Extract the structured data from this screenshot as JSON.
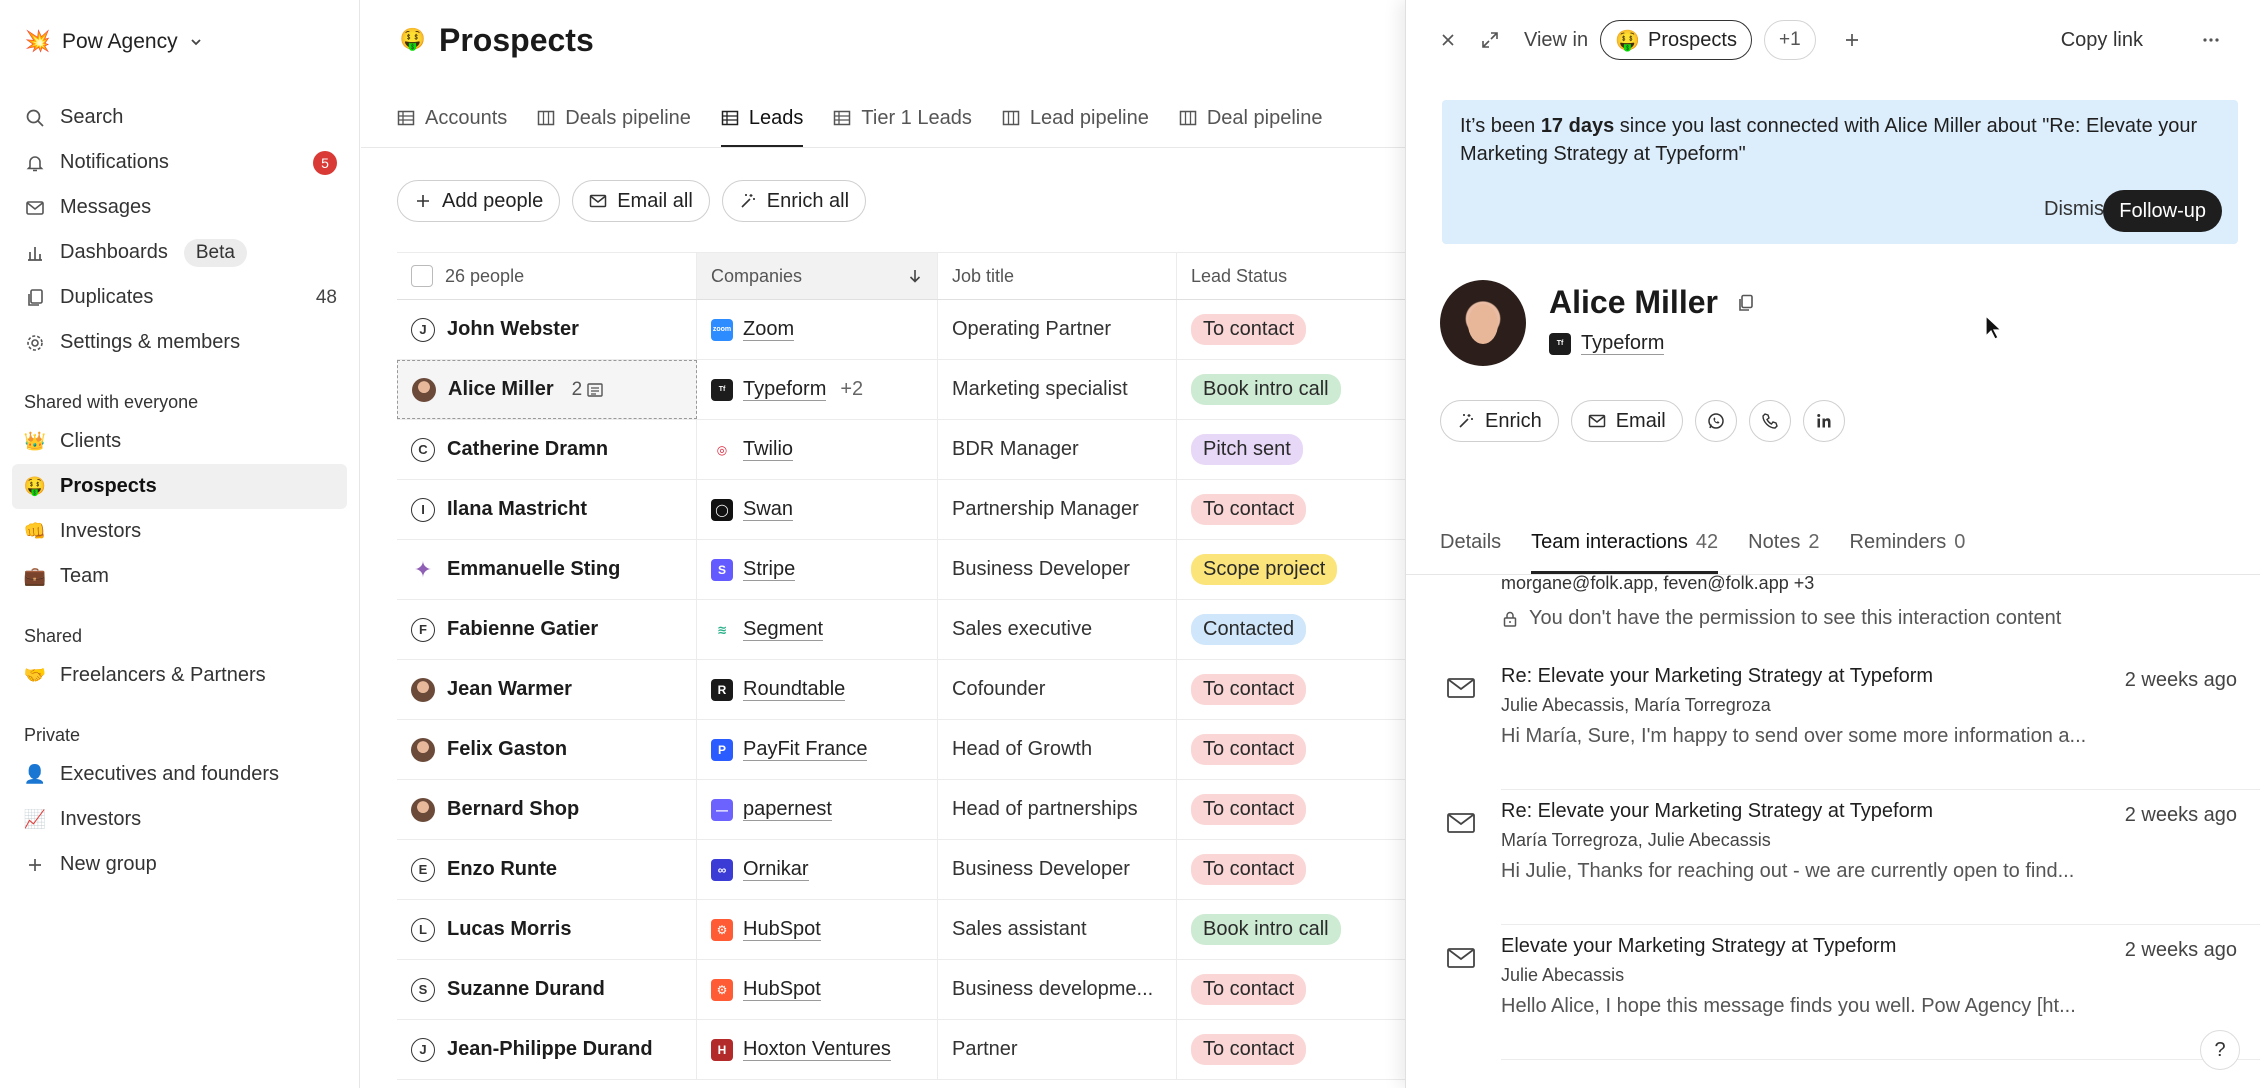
{
  "workspace": {
    "name": "Pow Agency",
    "emoji": "💥"
  },
  "sidebar": {
    "main_items": [
      {
        "label": "Search"
      },
      {
        "label": "Notifications",
        "badge": "5"
      },
      {
        "label": "Messages"
      },
      {
        "label": "Dashboards",
        "tag": "Beta"
      },
      {
        "label": "Duplicates",
        "count": "48"
      },
      {
        "label": "Settings & members"
      }
    ],
    "shared_everyone_title": "Shared with everyone",
    "shared_everyone": [
      {
        "emoji": "👑",
        "label": "Clients"
      },
      {
        "emoji": "🤑",
        "label": "Prospects"
      },
      {
        "emoji": "👊",
        "label": "Investors"
      },
      {
        "emoji": "💼",
        "label": "Team"
      }
    ],
    "shared_title": "Shared",
    "shared": [
      {
        "emoji": "🤝",
        "label": "Freelancers & Partners"
      }
    ],
    "private_title": "Private",
    "private": [
      {
        "emoji": "👤",
        "label": "Executives and founders"
      },
      {
        "emoji": "📈",
        "label": "Investors"
      }
    ],
    "new_group": "New group"
  },
  "main": {
    "title": "Prospects",
    "title_emoji": "🤑",
    "tabs": [
      "Accounts",
      "Deals pipeline",
      "Leads",
      "Tier 1 Leads",
      "Lead pipeline",
      "Deal pipeline"
    ],
    "actions": {
      "add": "Add people",
      "email": "Email all",
      "enrich": "Enrich all"
    },
    "table": {
      "header": {
        "people": "26 people",
        "companies": "Companies",
        "job": "Job title",
        "status": "Lead Status"
      },
      "rows": [
        {
          "name": "John Webster",
          "initial": "J",
          "company": "Zoom",
          "job": "Operating Partner",
          "status": "To contact"
        },
        {
          "name": "Alice Miller",
          "initial": "",
          "notes": "2",
          "company": "Typeform",
          "more": "+2",
          "job": "Marketing specialist",
          "status": "Book intro call"
        },
        {
          "name": "Catherine Dramn",
          "initial": "C",
          "company": "Twilio",
          "job": "BDR Manager",
          "status": "Pitch sent"
        },
        {
          "name": "Ilana Mastricht",
          "initial": "I",
          "company": "Swan",
          "job": "Partnership Manager",
          "status": "To contact"
        },
        {
          "name": "Emmanuelle Sting",
          "initial": "",
          "company": "Stripe",
          "job": "Business Developer",
          "status": "Scope project"
        },
        {
          "name": "Fabienne Gatier",
          "initial": "F",
          "company": "Segment",
          "job": "Sales executive",
          "status": "Contacted"
        },
        {
          "name": "Jean Warmer",
          "initial": "",
          "company": "Roundtable",
          "job": "Cofounder",
          "status": "To contact"
        },
        {
          "name": "Felix Gaston",
          "initial": "",
          "company": "PayFit France",
          "job": "Head of Growth",
          "status": "To contact"
        },
        {
          "name": "Bernard Shop",
          "initial": "",
          "company": "papernest",
          "job": "Head of partnerships",
          "status": "To contact"
        },
        {
          "name": "Enzo Runte",
          "initial": "E",
          "company": "Ornikar",
          "job": "Business Developer",
          "status": "To contact"
        },
        {
          "name": "Lucas Morris",
          "initial": "L",
          "company": "HubSpot",
          "job": "Sales assistant",
          "status": "Book intro call"
        },
        {
          "name": "Suzanne Durand",
          "initial": "S",
          "company": "HubSpot",
          "job": "Business developme...",
          "status": "To contact"
        },
        {
          "name": "Jean-Philippe Durand",
          "initial": "J",
          "company": "Hoxton Ventures",
          "job": "Partner",
          "status": "To contact"
        }
      ]
    }
  },
  "status_colors": {
    "To contact": "#fbd6d6",
    "Book intro call": "#cdebd3",
    "Pitch sent": "#e8d8f7",
    "Scope project": "#fbe57a",
    "Contacted": "#cfe6fb"
  },
  "company_colors": {
    "Zoom": "#2d8cff",
    "Typeform": "#1c1c1c",
    "Twilio": "#ffffff",
    "Swan": "#111111",
    "Stripe": "#635bff",
    "Segment": "#ffffff",
    "Roundtable": "#1a1a1a",
    "PayFit France": "#2b5cff",
    "papernest": "#6c63ff",
    "Ornikar": "#3b3bd6",
    "HubSpot": "#ff5c35",
    "Hoxton Ventures": "#b32a2a"
  },
  "panel": {
    "view_in": "View in",
    "view_chip": "Prospects",
    "view_more": "+1",
    "copy_link": "Copy link",
    "banner": {
      "pre": "It’s been ",
      "days": "17 days",
      "post": " since you last connected with Alice Miller about \"Re: Elevate your Marketing Strategy at Typeform\"",
      "dismiss": "Dismiss",
      "followup": "Follow-up"
    },
    "person": {
      "name": "Alice Miller",
      "company": "Typeform"
    },
    "actions": {
      "enrich": "Enrich",
      "email": "Email"
    },
    "tabs": [
      {
        "label": "Details",
        "count": ""
      },
      {
        "label": "Team interactions",
        "count": "42"
      },
      {
        "label": "Notes",
        "count": "2"
      },
      {
        "label": "Reminders",
        "count": "0"
      }
    ],
    "feed": {
      "fragment": "morgane@folk.app, feven@folk.app +3",
      "locked": "You don't have the permission to see this interaction content",
      "items": [
        {
          "subject": "Re: Elevate your Marketing Strategy at Typeform",
          "who": "Julie Abecassis, María Torregroza",
          "snippet": "Hi María, Sure, I'm happy to send over some more information a...",
          "when": "2 weeks ago"
        },
        {
          "subject": "Re: Elevate your Marketing Strategy at Typeform",
          "who": "María Torregroza, Julie Abecassis",
          "snippet": "Hi Julie, Thanks for reaching out - we are currently open to find...",
          "when": "2 weeks ago"
        },
        {
          "subject": "Elevate your Marketing Strategy at Typeform",
          "who": "Julie Abecassis",
          "snippet": "Hello Alice, I hope this message finds you well. Pow Agency [ht...",
          "when": "2 weeks ago"
        }
      ]
    },
    "help": "?"
  }
}
